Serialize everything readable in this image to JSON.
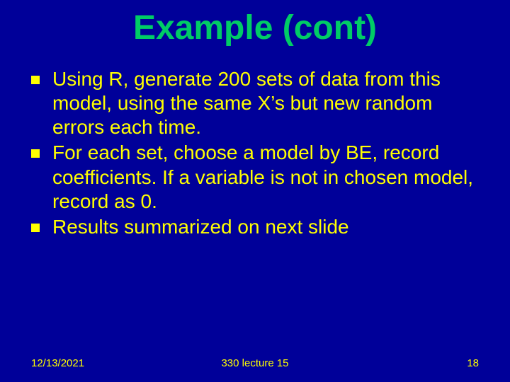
{
  "title": "Example (cont)",
  "bullets": [
    "Using R, generate 200 sets of data from this model, using the same X’s but new random errors each time.",
    "For each set, choose a model by BE, record coefficients. If a variable is not in chosen model, record as 0.",
    "Results summarized on next slide"
  ],
  "footer": {
    "date": "12/13/2021",
    "center": "330 lecture 15",
    "page": "18"
  }
}
